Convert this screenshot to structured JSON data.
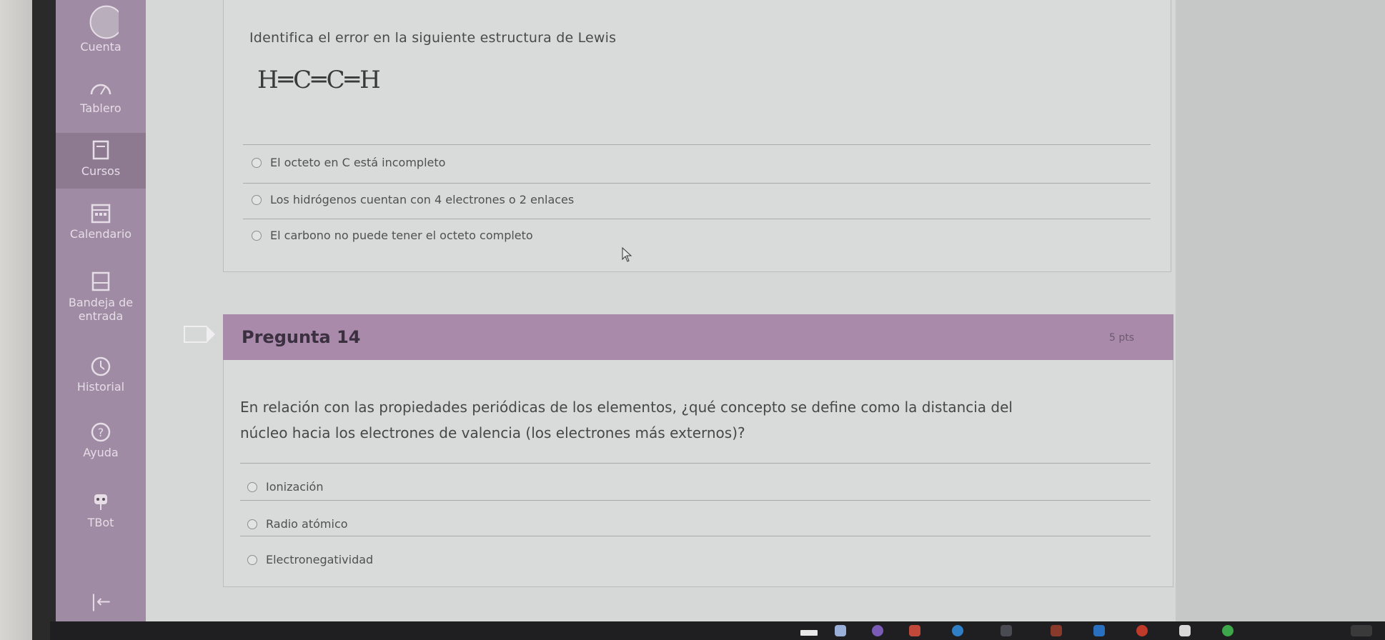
{
  "sidebar": {
    "items": [
      {
        "label": "Cuenta",
        "icon": "account-icon"
      },
      {
        "label": "Tablero",
        "icon": "dashboard-icon"
      },
      {
        "label": "Cursos",
        "icon": "courses-icon"
      },
      {
        "label": "Calendario",
        "icon": "calendar-icon"
      },
      {
        "label": "Bandeja de entrada",
        "icon": "inbox-icon"
      },
      {
        "label": "Historial",
        "icon": "history-icon"
      },
      {
        "label": "Ayuda",
        "icon": "help-icon"
      },
      {
        "label": "TBot",
        "icon": "robot-icon"
      }
    ],
    "collapse_icon": "collapse-arrow-icon"
  },
  "prev_question": {
    "prompt": "Identifica el error en la siguiente estructura de Lewis",
    "formula": "H═C═C═H",
    "options": [
      "El octeto en C está incompleto",
      "Los hidrógenos cuentan con 4 electrones o 2 enlaces",
      "El carbono no puede tener el octeto completo"
    ]
  },
  "question14": {
    "title": "Pregunta 14",
    "points": "5 pts",
    "prompt_line1": "En relación con las propiedades periódicas de los elementos, ¿qué concepto se define como la distancia del",
    "prompt_line2": "núcleo hacia los electrones de valencia (los electrones más externos)?",
    "options": [
      "Ionización",
      "Radio atómico",
      "Electronegatividad"
    ]
  },
  "colors": {
    "sidebar": "#9f8ba3",
    "header": "#a98aaa"
  }
}
